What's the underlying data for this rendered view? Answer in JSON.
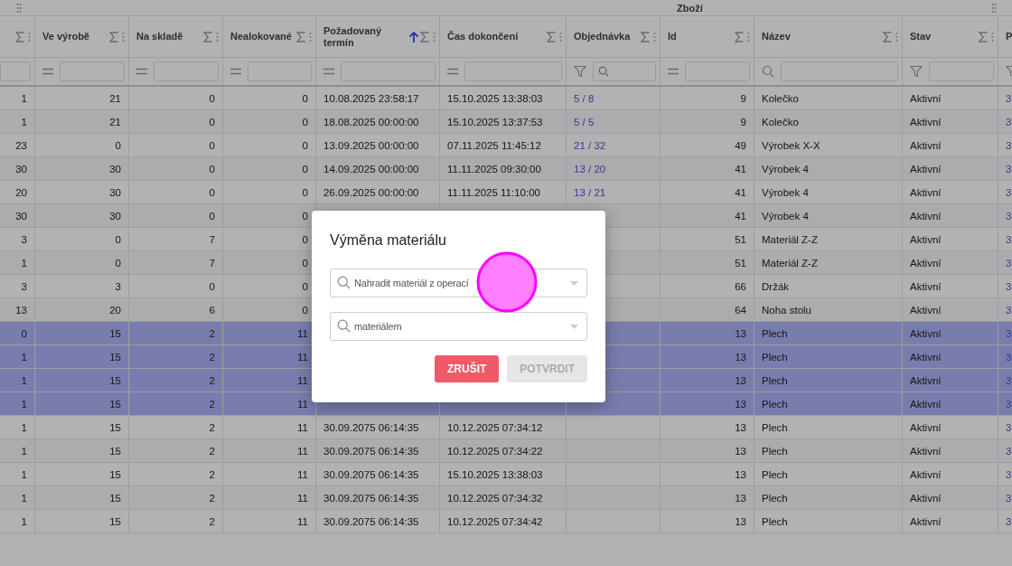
{
  "table": {
    "header_groups": [
      {
        "columns": [
          {
            "kind": "plain",
            "sorted": false
          },
          {
            "label": "Ve výrobě",
            "kind": "equals",
            "sorted": false
          },
          {
            "label": "Na skladě",
            "kind": "equals",
            "sorted": false
          },
          {
            "label": "Nealokované",
            "kind": "equals",
            "sorted": false
          },
          {
            "label": "Požadovaný termín",
            "kind": "equals",
            "sorted": true
          },
          {
            "label": "Čas dokončení",
            "kind": "equals",
            "sorted": false
          },
          {
            "label": "Objednávka",
            "kind": "list_search",
            "sorted": false
          }
        ]
      },
      {
        "label": "Zboží",
        "columns": [
          {
            "label": "Id",
            "kind": "equals",
            "sorted": false
          },
          {
            "label": "Název",
            "kind": "search",
            "sorted": false
          },
          {
            "label": "Stav",
            "kind": "list",
            "sorted": false
          }
        ]
      },
      {
        "columns": [
          {
            "label": "P",
            "kind": "list",
            "sorted": false
          }
        ]
      }
    ],
    "rows": [
      {
        "selected": false,
        "cells": [
          "1",
          "21",
          "0",
          "0",
          "10.08.2025 23:58:17",
          "15.10.2025 13:38:03",
          "5 / 8",
          "9",
          "Kolečko",
          "Aktivní",
          "3"
        ]
      },
      {
        "selected": false,
        "cells": [
          "1",
          "21",
          "0",
          "0",
          "18.08.2025 00:00:00",
          "15.10.2025 13:37:53",
          "5 / 5",
          "9",
          "Kolečko",
          "Aktivní",
          "3"
        ]
      },
      {
        "selected": false,
        "cells": [
          "23",
          "0",
          "0",
          "0",
          "13.09.2025 00:00:00",
          "07.11.2025 11:45:12",
          "21 / 32",
          "49",
          "Výrobek X-X",
          "Aktivní",
          "3"
        ]
      },
      {
        "selected": false,
        "cells": [
          "30",
          "30",
          "0",
          "0",
          "14.09.2025 00:00:00",
          "11.11.2025 09:30:00",
          "13 / 20",
          "41",
          "Výrobek 4",
          "Aktivní",
          "3"
        ]
      },
      {
        "selected": false,
        "cells": [
          "20",
          "30",
          "0",
          "0",
          "26.09.2025 00:00:00",
          "11.11.2025 11:10:00",
          "13 / 21",
          "41",
          "Výrobek 4",
          "Aktivní",
          "3"
        ]
      },
      {
        "selected": false,
        "cells": [
          "30",
          "30",
          "0",
          "0",
          null,
          null,
          null,
          "41",
          "Výrobek 4",
          "Aktivní",
          "3"
        ]
      },
      {
        "selected": false,
        "cells": [
          "3",
          "0",
          "7",
          "0",
          null,
          null,
          null,
          "51",
          "Materiál Z-Z",
          "Aktivní",
          "3"
        ]
      },
      {
        "selected": false,
        "cells": [
          "1",
          "0",
          "7",
          "0",
          null,
          null,
          null,
          "51",
          "Materiál Z-Z",
          "Aktivní",
          "3"
        ]
      },
      {
        "selected": false,
        "cells": [
          "3",
          "3",
          "0",
          "0",
          null,
          null,
          null,
          "66",
          "Držák",
          "Aktivní",
          "3"
        ]
      },
      {
        "selected": false,
        "cells": [
          "13",
          "20",
          "6",
          "0",
          null,
          null,
          null,
          "64",
          "Noha stolu",
          "Aktivní",
          "3"
        ]
      },
      {
        "selected": true,
        "cells": [
          "0",
          "15",
          "2",
          "11",
          null,
          null,
          null,
          "13",
          "Plech",
          "Aktivní",
          "3"
        ]
      },
      {
        "selected": true,
        "cells": [
          "1",
          "15",
          "2",
          "11",
          null,
          null,
          null,
          "13",
          "Plech",
          "Aktivní",
          "3"
        ]
      },
      {
        "selected": true,
        "cells": [
          "1",
          "15",
          "2",
          "11",
          null,
          null,
          null,
          "13",
          "Plech",
          "Aktivní",
          "3"
        ]
      },
      {
        "selected": true,
        "cells": [
          "1",
          "15",
          "2",
          "11",
          null,
          null,
          null,
          "13",
          "Plech",
          "Aktivní",
          "3"
        ]
      },
      {
        "selected": false,
        "cells": [
          "1",
          "15",
          "2",
          "11",
          "30.09.2075 06:14:35",
          "10.12.2025 07:34:12",
          null,
          "13",
          "Plech",
          "Aktivní",
          "3"
        ]
      },
      {
        "selected": false,
        "cells": [
          "1",
          "15",
          "2",
          "11",
          "30.09.2075 06:14:35",
          "10.12.2025 07:34:22",
          null,
          "13",
          "Plech",
          "Aktivní",
          "3"
        ]
      },
      {
        "selected": false,
        "cells": [
          "1",
          "15",
          "2",
          "11",
          "30.09.2075 06:14:35",
          "15.10.2025 13:38:03",
          null,
          "13",
          "Plech",
          "Aktivní",
          "3"
        ]
      },
      {
        "selected": false,
        "cells": [
          "1",
          "15",
          "2",
          "11",
          "30.09.2075 06:14:35",
          "10.12.2025 07:34:32",
          null,
          "13",
          "Plech",
          "Aktivní",
          "3"
        ]
      },
      {
        "selected": false,
        "cells": [
          "1",
          "15",
          "2",
          "11",
          "30.09.2075 06:14:35",
          "10.12.2025 07:34:42",
          null,
          "13",
          "Plech",
          "Aktivní",
          "3"
        ]
      }
    ]
  },
  "dialog": {
    "title": "Výměna materiálu",
    "fields": [
      {
        "placeholder": "Nahradit materiál z operací"
      },
      {
        "placeholder": "materiálem"
      }
    ],
    "buttons": [
      {
        "label": "ZRUŠIT",
        "kind": "cancel",
        "disabled": false
      },
      {
        "label": "POTVRDIT",
        "kind": "confirm",
        "disabled": true
      }
    ]
  }
}
